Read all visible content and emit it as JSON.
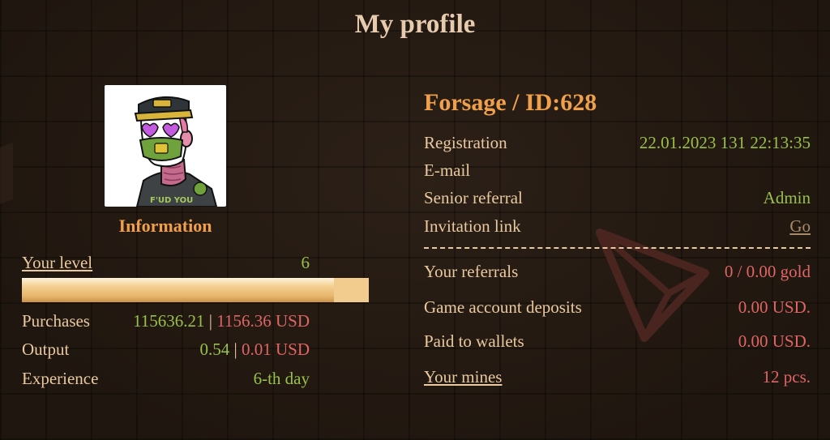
{
  "page": {
    "title": "My profile"
  },
  "info": {
    "title": "Information",
    "level": {
      "label": "Your level",
      "value": "6",
      "progress_fraction": 0.9
    },
    "purchases": {
      "label": "Purchases",
      "amount": "115636.21",
      "sep": "|",
      "usd": "1156.36 USD"
    },
    "output": {
      "label": "Output",
      "amount": "0.54",
      "sep": "|",
      "usd": "0.01 USD"
    },
    "experience": {
      "label": "Experience",
      "value": "6-th day"
    }
  },
  "profile": {
    "title": "Forsage / ID:628",
    "registration": {
      "label": "Registration",
      "value": "22.01.2023 131 22:13:35"
    },
    "email": {
      "label": "E-mail",
      "value": ""
    },
    "senior_referral": {
      "label": "Senior referral",
      "value": "Admin"
    },
    "invitation_link": {
      "label": "Invitation link",
      "value": "Go"
    }
  },
  "stats": {
    "referrals": {
      "label": "Your referrals",
      "value": "0 / 0.00 gold"
    },
    "deposits": {
      "label": "Game account deposits",
      "value": "0.00 USD."
    },
    "paid": {
      "label": "Paid to wallets",
      "value": "0.00 USD."
    },
    "mines": {
      "label": "Your mines",
      "value": "12 pcs."
    }
  },
  "avatar": {
    "caption": "F'UD YOU"
  },
  "colors": {
    "accent": "#f0a04a",
    "positive": "#97c14a",
    "negative": "#e06565",
    "text": "#e9c9a0",
    "background": "#241a12"
  }
}
